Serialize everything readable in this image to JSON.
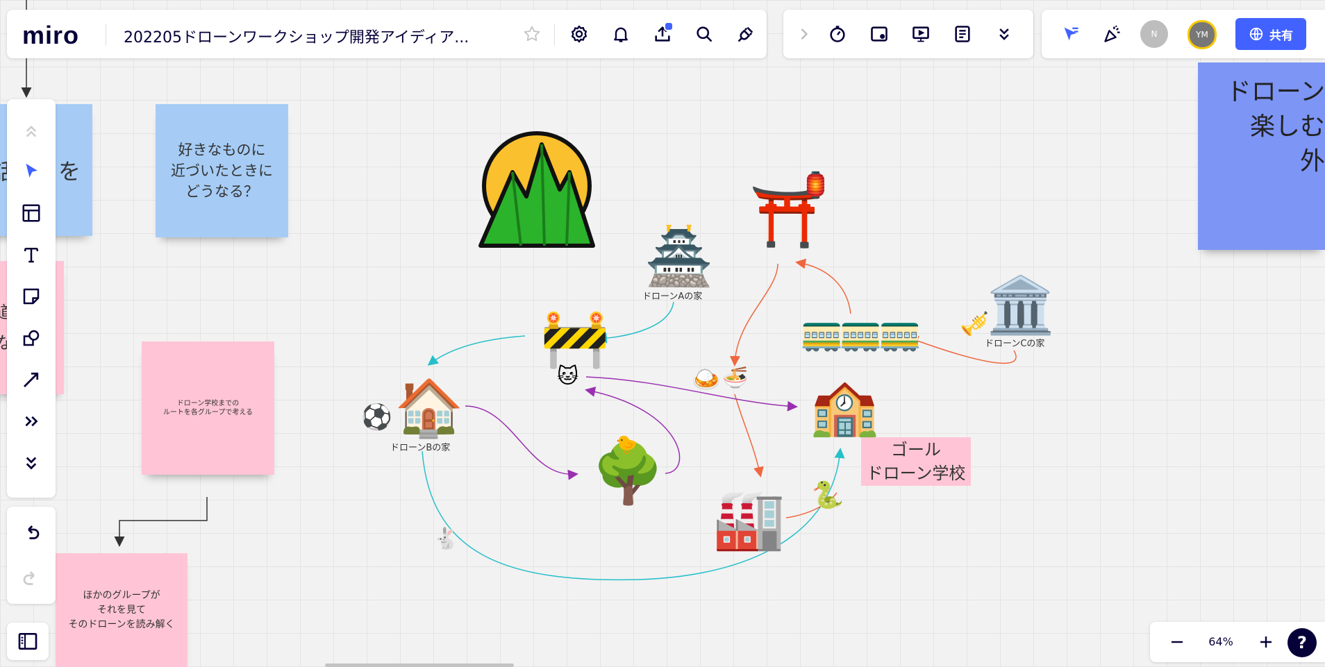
{
  "app": {
    "logo": "miro",
    "board_title": "202205ドローンワークショップ開発アイディア..."
  },
  "topbar": {
    "icons": [
      "star-icon",
      "settings-icon",
      "bell-icon",
      "upload-icon",
      "search-icon",
      "plug-icon"
    ],
    "tools": [
      "chevron-right-icon",
      "timer-icon",
      "frame-icon",
      "present-icon",
      "notes-icon",
      "more-icon"
    ],
    "share_label": "共有",
    "avatars": [
      {
        "initial": "N",
        "color": "#bdbdbd"
      },
      {
        "initial": "YM",
        "color": "#777777"
      }
    ]
  },
  "stickies": {
    "blue_left_partial": "話　　を",
    "blue_question": "好きなものに\n近づいたときに\nどうなる？",
    "pink_left_partial": "道\nな",
    "pink_route": "ドローン学校までの\nルートを各グループで考える",
    "pink_read": "ほかのグループが\nそれを見て\nそのドローンを読み解く",
    "purple_right": "ドローン\n楽しむ\n外"
  },
  "map": {
    "house_a_label": "ドローンAの家",
    "house_b_label": "ドローンBの家",
    "house_c_label": "ドローンCの家",
    "goal_label": "ゴール\nドローン学校"
  },
  "zoom": {
    "level": "64%"
  },
  "colors": {
    "accent": "#4262ff",
    "cyan": "#26bfc9",
    "orange": "#f0663e",
    "purple": "#9a2fb0"
  }
}
